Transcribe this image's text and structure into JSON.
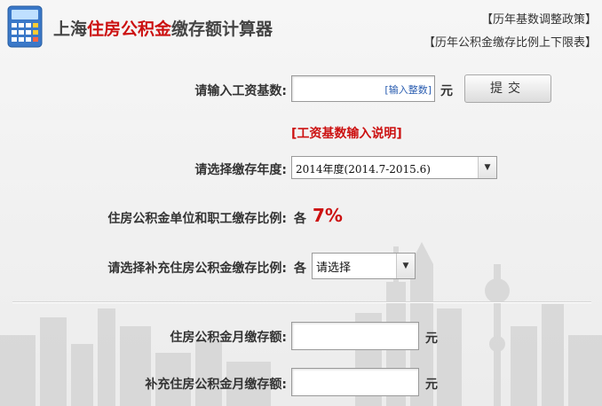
{
  "header": {
    "title_prefix": "上海",
    "title_highlight": "住房公积金",
    "title_suffix": "缴存额计算器",
    "links": [
      "【历年基数调整政策】",
      "【历年公积金缴存比例上下限表】"
    ]
  },
  "form": {
    "salary_label": "请输入工资基数:",
    "salary_hint": "[输入整数]",
    "salary_value": "",
    "unit_yuan": "元",
    "submit_label": "提交",
    "salary_help_link": "[工资基数输入说明]",
    "year_label": "请选择缴存年度:",
    "year_selected": "2014年度(2014.7-2015.6)",
    "ratio_label": "住房公积金单位和职工缴存比例:",
    "ratio_prefix": "各",
    "ratio_value": "7%",
    "supp_ratio_label": "请选择补充住房公积金缴存比例:",
    "supp_ratio_prefix": "各",
    "supp_ratio_selected": "请选择"
  },
  "results": {
    "monthly_label": "住房公积金月缴存额:",
    "monthly_value": "",
    "supp_monthly_label": "补充住房公积金月缴存额:",
    "supp_monthly_value": "",
    "unit_yuan": "元"
  },
  "colors": {
    "accent": "#cc1111",
    "hint_blue": "#2a5db0"
  },
  "icons": {
    "logo": "calculator-icon"
  }
}
